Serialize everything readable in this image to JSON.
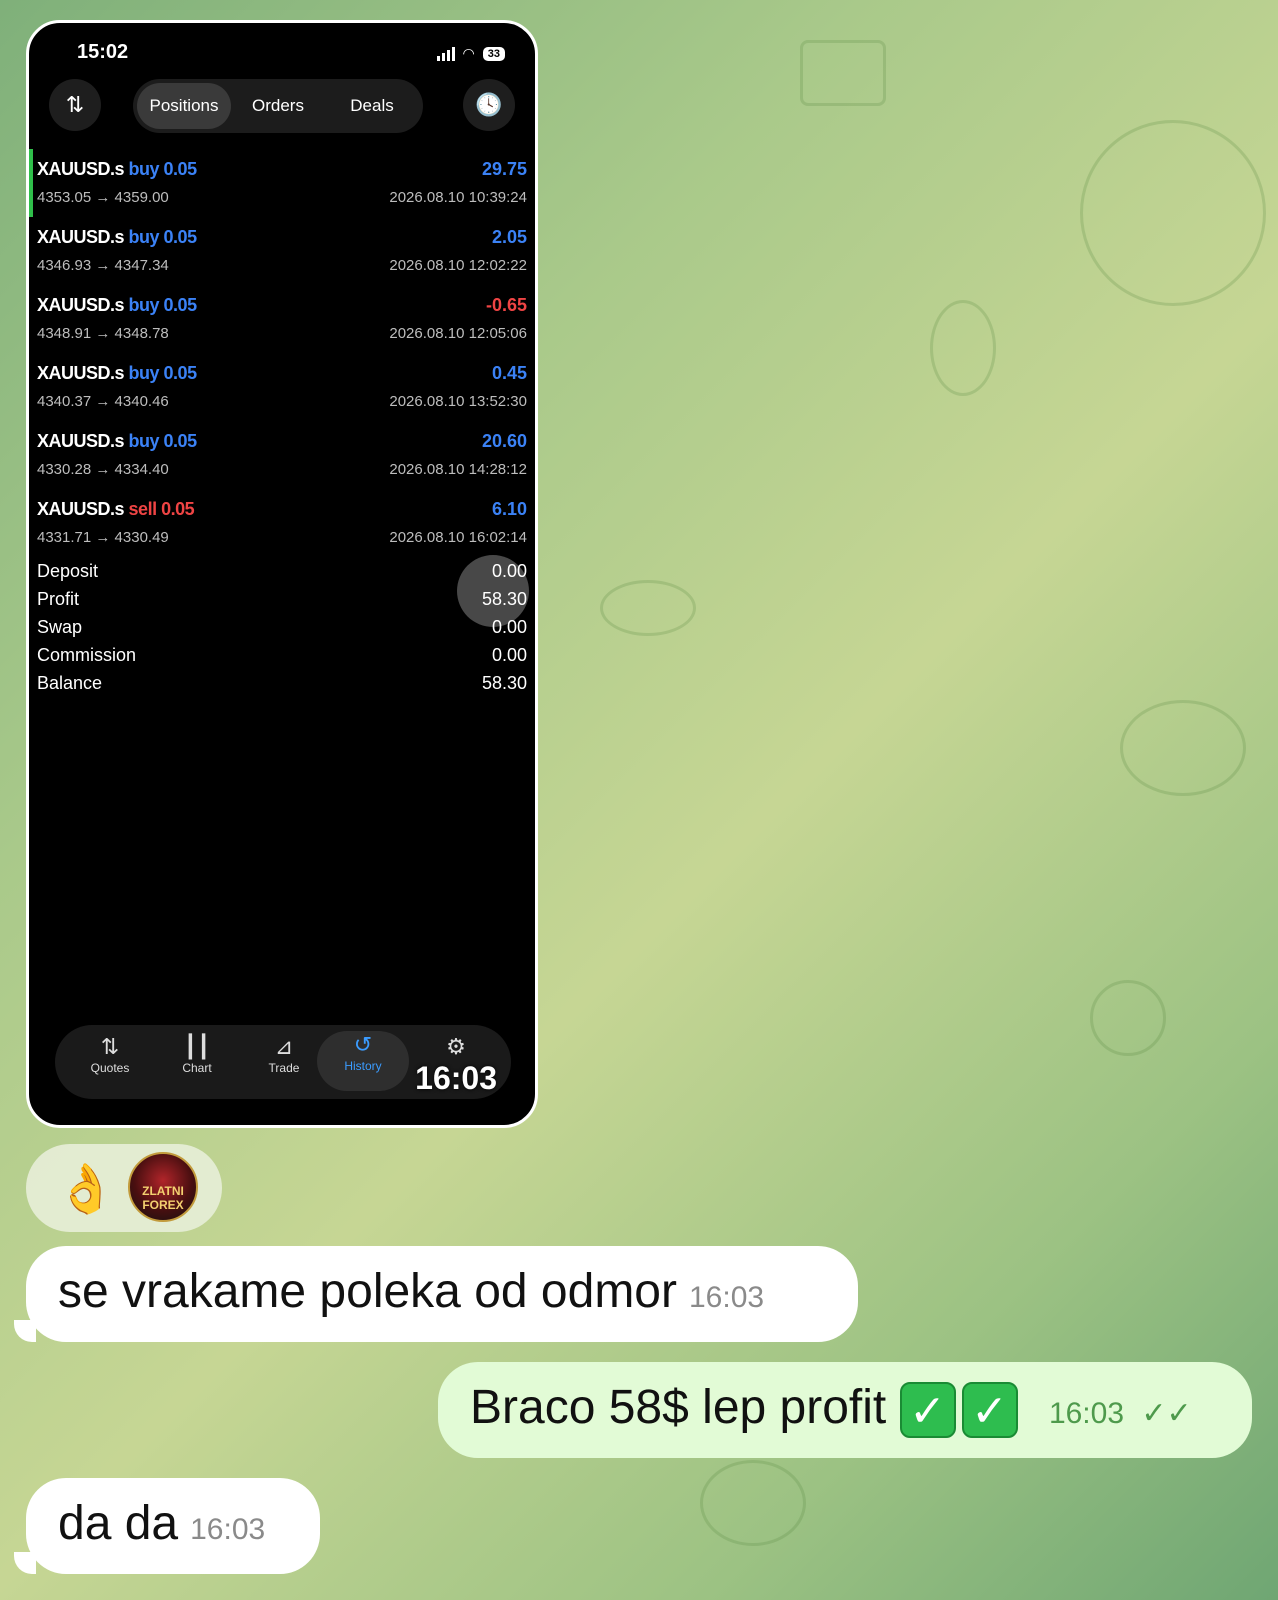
{
  "phone": {
    "status_time": "15:02",
    "battery": "33",
    "tabs": [
      "Positions",
      "Orders",
      "Deals"
    ],
    "deals": [
      {
        "symbol": "XAUUSD.s",
        "side": "buy 0.05",
        "prices": "4353.05 → 4359.00",
        "profit": "29.75",
        "time": "2026.08.10 10:39:24"
      },
      {
        "symbol": "XAUUSD.s",
        "side": "buy 0.05",
        "prices": "4346.93 → 4347.34",
        "profit": "2.05",
        "time": "2026.08.10 12:02:22"
      },
      {
        "symbol": "XAUUSD.s",
        "side": "buy 0.05",
        "prices": "4348.91 → 4348.78",
        "profit": "-0.65",
        "time": "2026.08.10 12:05:06"
      },
      {
        "symbol": "XAUUSD.s",
        "side": "buy 0.05",
        "prices": "4340.37 → 4340.46",
        "profit": "0.45",
        "time": "2026.08.10 13:52:30"
      },
      {
        "symbol": "XAUUSD.s",
        "side": "buy 0.05",
        "prices": "4330.28 → 4334.40",
        "profit": "20.60",
        "time": "2026.08.10 14:28:12"
      },
      {
        "symbol": "XAUUSD.s",
        "side": "sell 0.05",
        "prices": "4331.71 → 4330.49",
        "profit": "6.10",
        "time": "2026.08.10 16:02:14"
      }
    ],
    "summary": [
      {
        "label": "Deposit",
        "value": "0.00"
      },
      {
        "label": "Profit",
        "value": "58.30"
      },
      {
        "label": "Swap",
        "value": "0.00"
      },
      {
        "label": "Commission",
        "value": "0.00"
      },
      {
        "label": "Balance",
        "value": "58.30"
      }
    ],
    "nav": [
      "Quotes",
      "Chart",
      "Trade",
      "History"
    ],
    "overlay_time": "16:03",
    "colors": {
      "buy": "#3b82f6",
      "sell": "#ef4444",
      "active_nav": "#3b9cff"
    }
  },
  "reaction": {
    "emoji": "👌",
    "avatar_text": "ZLATNI FOREX"
  },
  "messages": [
    {
      "text": "se vrakame poleka od odmor",
      "time": "16:03"
    },
    {
      "text": "Braco 58$ lep profit",
      "time": "16:03",
      "check": "✓"
    },
    {
      "text": "da da",
      "time": "16:03"
    }
  ]
}
